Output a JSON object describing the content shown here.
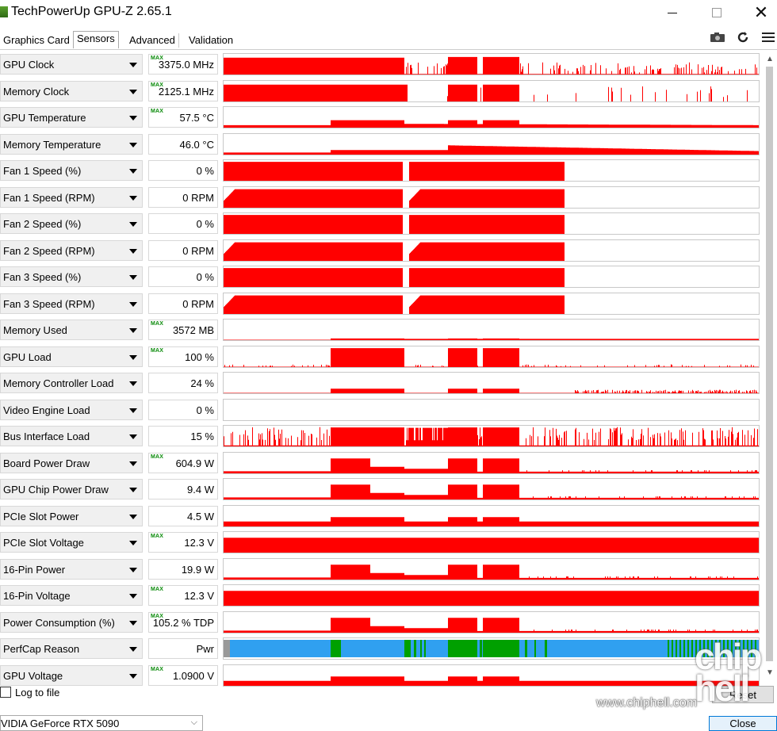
{
  "window": {
    "title": "TechPowerUp GPU-Z 2.65.1",
    "icon": "gpu-z-app-icon",
    "buttons": [
      "minimize",
      "maximize",
      "close"
    ]
  },
  "tabs": [
    {
      "label": "Graphics Card",
      "active": false
    },
    {
      "label": "Sensors",
      "active": true
    },
    {
      "label": "Advanced",
      "active": false
    },
    {
      "label": "Validation",
      "active": false
    }
  ],
  "toolbar_icons": [
    "camera-icon",
    "refresh-icon",
    "hamburger-menu-icon"
  ],
  "colors": {
    "graph_red": "#ff0000",
    "perfcap_blue": "#30a0f0",
    "perfcap_green": "#00a000",
    "max_tag_green": "#0a8a0a"
  },
  "max_tag": "MAX",
  "sensors": [
    {
      "label": "GPU Clock",
      "value": "3375.0 MHz",
      "max": true
    },
    {
      "label": "Memory Clock",
      "value": "2125.1 MHz",
      "max": true
    },
    {
      "label": "GPU Temperature",
      "value": "57.5 °C",
      "max": true
    },
    {
      "label": "Memory Temperature",
      "value": "46.0 °C",
      "max": false
    },
    {
      "label": "Fan 1 Speed (%)",
      "value": "0 %",
      "max": false
    },
    {
      "label": "Fan 1 Speed (RPM)",
      "value": "0 RPM",
      "max": false
    },
    {
      "label": "Fan 2 Speed (%)",
      "value": "0 %",
      "max": false
    },
    {
      "label": "Fan 2 Speed (RPM)",
      "value": "0 RPM",
      "max": false
    },
    {
      "label": "Fan 3 Speed (%)",
      "value": "0 %",
      "max": false
    },
    {
      "label": "Fan 3 Speed (RPM)",
      "value": "0 RPM",
      "max": false
    },
    {
      "label": "Memory Used",
      "value": "3572 MB",
      "max": true
    },
    {
      "label": "GPU Load",
      "value": "100 %",
      "max": true
    },
    {
      "label": "Memory Controller Load",
      "value": "24 %",
      "max": false
    },
    {
      "label": "Video Engine Load",
      "value": "0 %",
      "max": false
    },
    {
      "label": "Bus Interface Load",
      "value": "15 %",
      "max": false
    },
    {
      "label": "Board Power Draw",
      "value": "604.9 W",
      "max": true
    },
    {
      "label": "GPU Chip Power Draw",
      "value": "9.4 W",
      "max": false
    },
    {
      "label": "PCIe Slot Power",
      "value": "4.5 W",
      "max": false
    },
    {
      "label": "PCIe Slot Voltage",
      "value": "12.3 V",
      "max": true
    },
    {
      "label": "16-Pin Power",
      "value": "19.9 W",
      "max": false
    },
    {
      "label": "16-Pin Voltage",
      "value": "12.3 V",
      "max": true
    },
    {
      "label": "Power Consumption (%)",
      "value": "105.2 % TDP",
      "max": true
    },
    {
      "label": "PerfCap Reason",
      "value": "Pwr",
      "max": false
    },
    {
      "label": "GPU Voltage",
      "value": "1.0900 V",
      "max": true
    }
  ],
  "footer": {
    "log_label": "Log to file",
    "log_checked": false,
    "reset_label": "Reset",
    "gpu_name": "VIDIA GeForce RTX 5090",
    "close_label": "Close"
  },
  "watermark": {
    "logo": "chip hell",
    "url": "www.chiphell.com"
  }
}
